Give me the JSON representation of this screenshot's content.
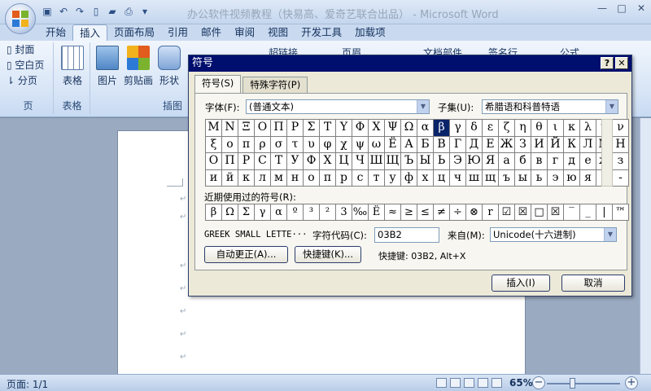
{
  "window": {
    "title": "办公软件视频教程（快易高、爱奇艺联合出品） - Microsoft Word",
    "controls": [
      "—",
      "□",
      "✕"
    ]
  },
  "ribbon_tabs": [
    "开始",
    "插入",
    "页面布局",
    "引用",
    "邮件",
    "审阅",
    "视图",
    "开发工具",
    "加载项"
  ],
  "active_tab": "插入",
  "ribbon": {
    "pages_group": {
      "items": [
        "封面",
        "空白页",
        "分页"
      ],
      "label": "页"
    },
    "table_group": {
      "button": "表格",
      "label": "表格"
    },
    "illustrations_group": {
      "buttons": [
        "图片",
        "剪贴画",
        "形状"
      ],
      "label": "插图"
    },
    "peek": [
      "超链接",
      "页眉",
      "文档部件",
      "签名行",
      "公式"
    ]
  },
  "status": {
    "page": "页面: 1/1",
    "zoom": "65%"
  },
  "dialog": {
    "title": "符号",
    "tabs": [
      "符号(S)",
      "特殊字符(P)"
    ],
    "font_label": "字体(F):",
    "font_value": "(普通文本)",
    "subset_label": "子集(U):",
    "subset_value": "希腊语和科普特语",
    "grid": [
      [
        "Μ",
        "Ν",
        "Ξ",
        "Ο",
        "Π",
        "Ρ",
        "Σ",
        "Τ",
        "Υ",
        "Φ",
        "Χ",
        "Ψ",
        "Ω",
        "α",
        "β",
        "γ",
        "δ",
        "ε",
        "ζ",
        "η",
        "θ",
        "ι",
        "κ",
        "λ",
        "μ",
        "ν"
      ],
      [
        "ξ",
        "ο",
        "π",
        "ρ",
        "σ",
        "τ",
        "υ",
        "φ",
        "χ",
        "ψ",
        "ω",
        "Ё",
        "А",
        "Б",
        "В",
        "Г",
        "Д",
        "Е",
        "Ж",
        "З",
        "И",
        "Й",
        "К",
        "Л",
        "М",
        "Н"
      ],
      [
        "О",
        "П",
        "Р",
        "С",
        "Т",
        "У",
        "Ф",
        "Х",
        "Ц",
        "Ч",
        "Ш",
        "Щ",
        "Ъ",
        "Ы",
        "Ь",
        "Э",
        "Ю",
        "Я",
        "а",
        "б",
        "в",
        "г",
        "д",
        "е",
        "ж",
        "з"
      ],
      [
        "и",
        "й",
        "к",
        "л",
        "м",
        "н",
        "о",
        "п",
        "р",
        "с",
        "т",
        "у",
        "ф",
        "х",
        "ц",
        "ч",
        "ш",
        "щ",
        "ъ",
        "ы",
        "ь",
        "э",
        "ю",
        "я",
        "ё",
        "-"
      ]
    ],
    "selected": {
      "row": 0,
      "col": 14
    },
    "recent_label": "近期使用过的符号(R):",
    "recent": [
      "β",
      "Ω",
      "Σ",
      "γ",
      "α",
      "º",
      "³",
      "²",
      "3",
      "‰",
      "Ë",
      "≈",
      "≥",
      "≤",
      "≠",
      "÷",
      "⊗",
      "r",
      "☑",
      "☒",
      "□",
      "☒",
      "‾",
      "_",
      "|",
      "™"
    ],
    "char_name": "GREEK SMALL LETTE···",
    "code_label": "字符代码(C):",
    "code_value": "03B2",
    "from_label": "来自(M):",
    "from_value": "Unicode(十六进制)",
    "autocorrect_btn": "自动更正(A)...",
    "shortcut_btn": "快捷键(K)...",
    "shortcut_text": "快捷键: 03B2, Alt+X",
    "insert_btn": "插入(I)",
    "cancel_btn": "取消"
  }
}
